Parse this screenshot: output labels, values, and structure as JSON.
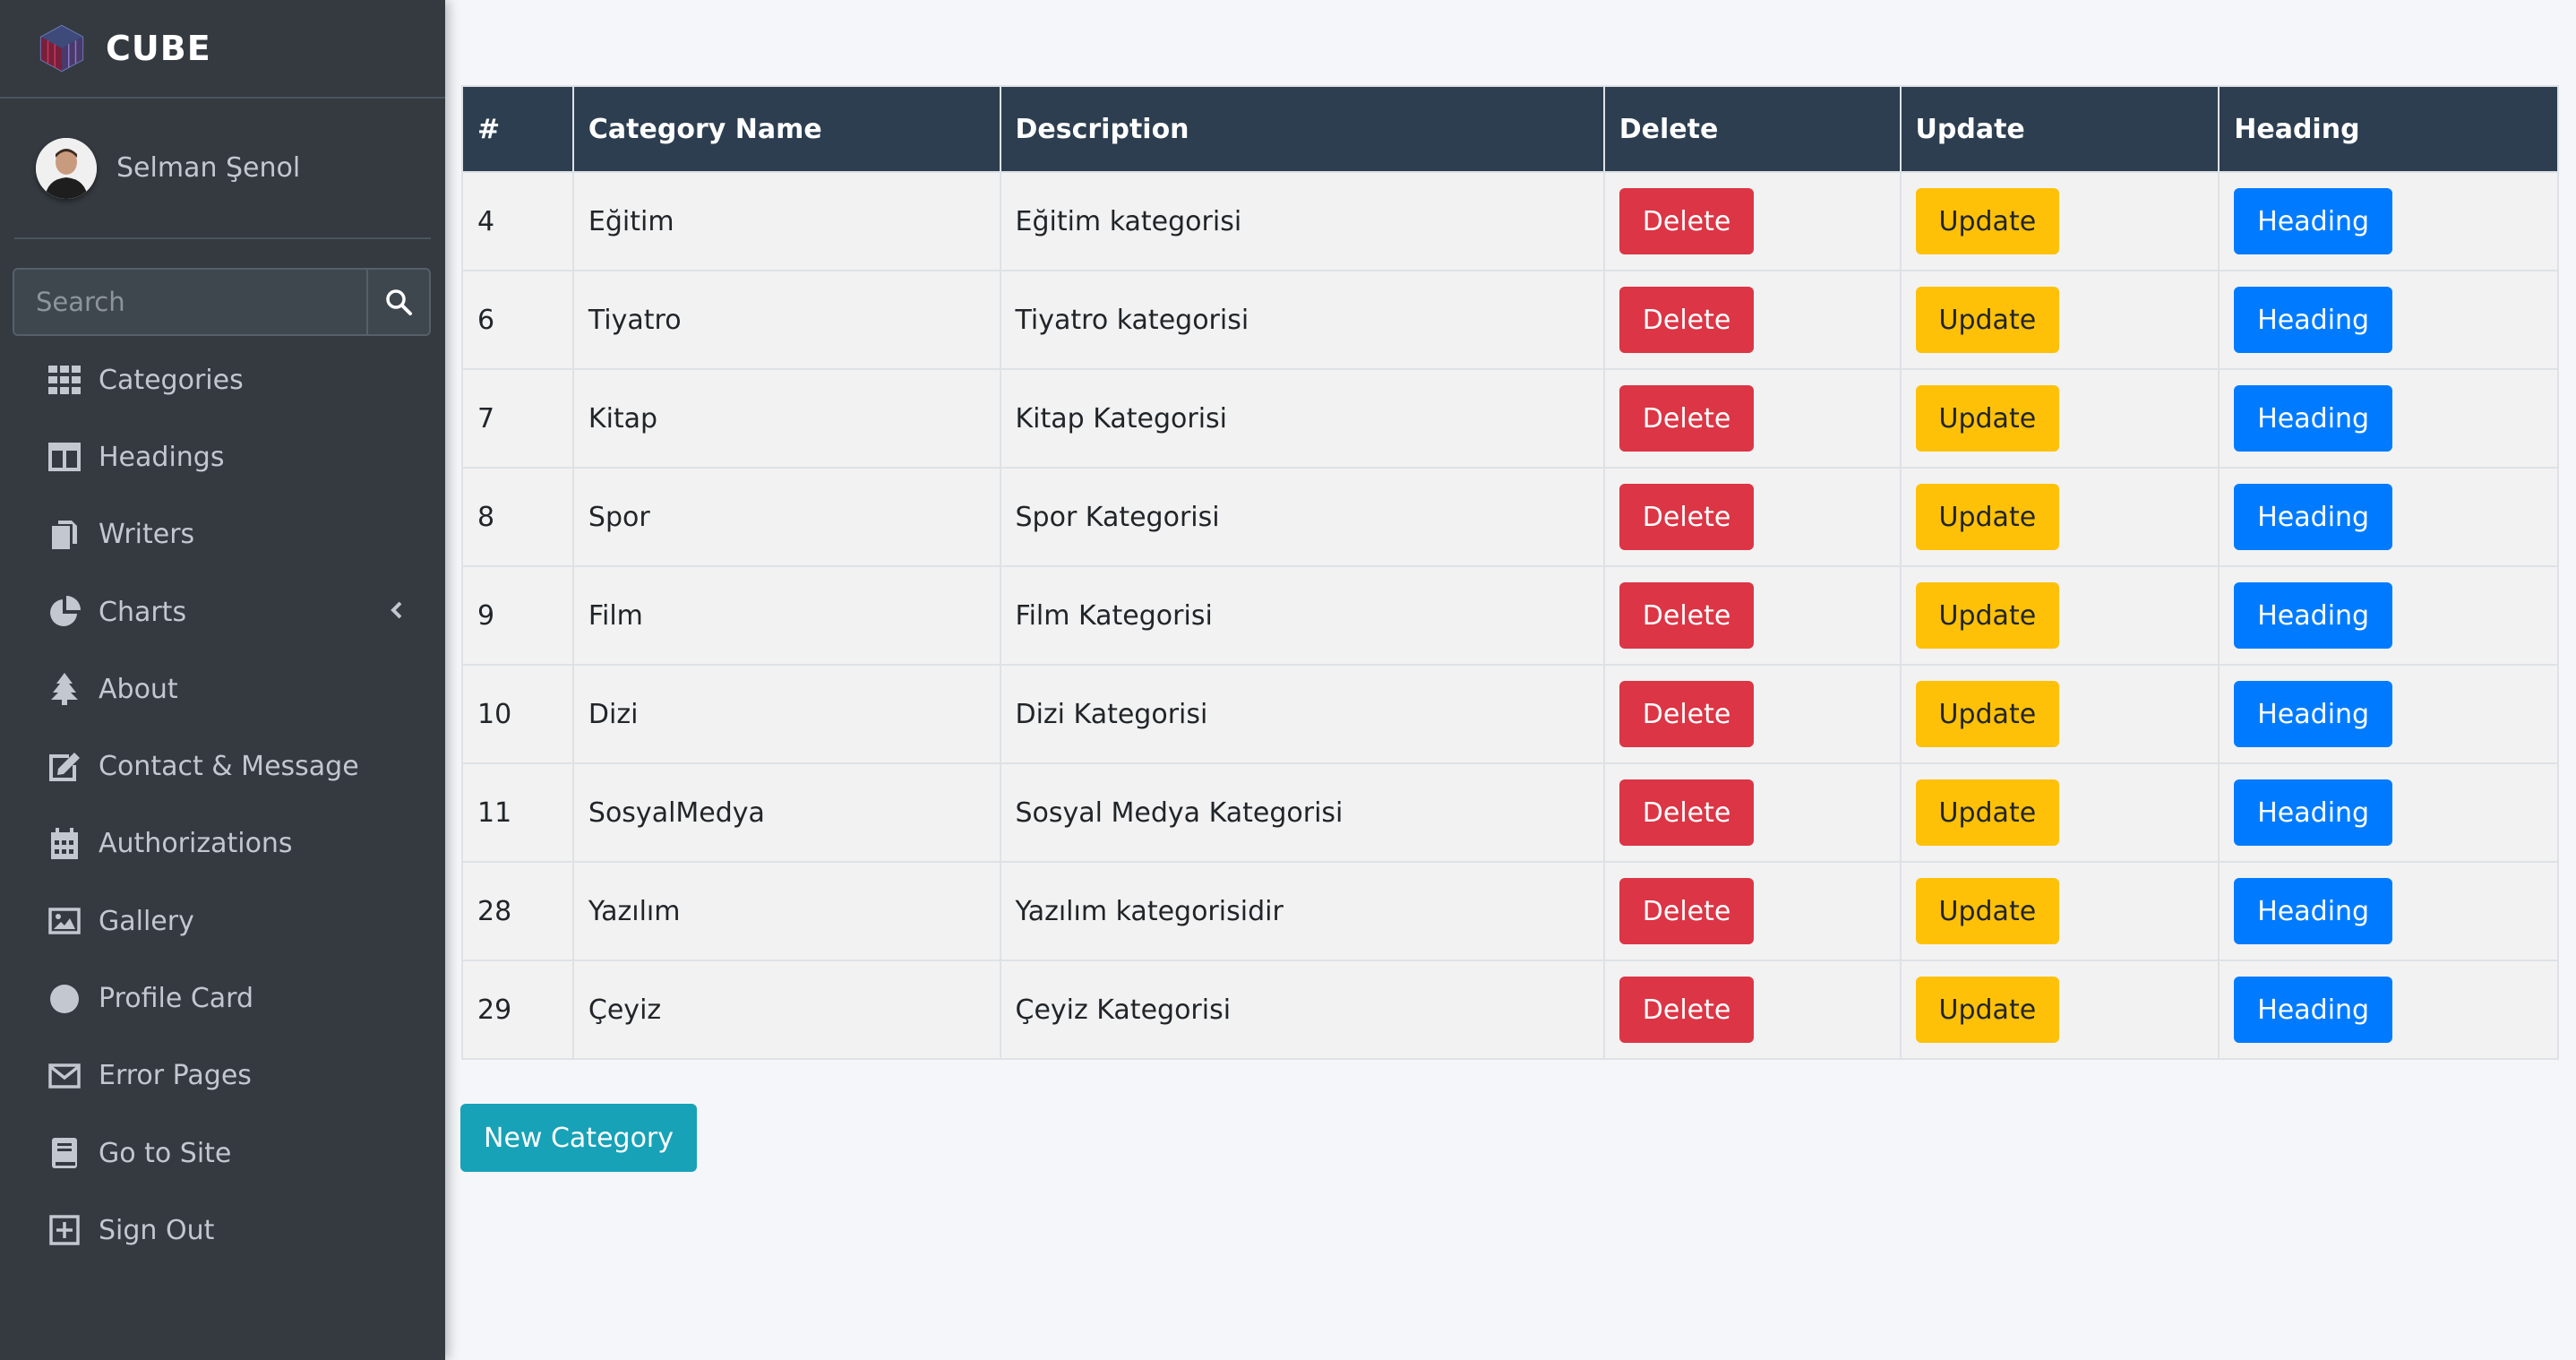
{
  "brand": {
    "name": "CUBE"
  },
  "user": {
    "name": "Selman Şenol"
  },
  "search": {
    "placeholder": "Search"
  },
  "sidebar": {
    "items": [
      {
        "label": "Categories",
        "icon": "grid-icon"
      },
      {
        "label": "Headings",
        "icon": "columns-icon"
      },
      {
        "label": "Writers",
        "icon": "copy-icon"
      },
      {
        "label": "Charts",
        "icon": "pie-chart-icon",
        "has_arrow": true
      },
      {
        "label": "About",
        "icon": "tree-icon"
      },
      {
        "label": "Contact & Message",
        "icon": "edit-icon"
      },
      {
        "label": "Authorizations",
        "icon": "calendar-icon"
      },
      {
        "label": "Gallery",
        "icon": "image-icon"
      },
      {
        "label": "Profile Card",
        "icon": "circle-icon"
      },
      {
        "label": "Error Pages",
        "icon": "envelope-icon"
      },
      {
        "label": "Go to Site",
        "icon": "book-icon"
      },
      {
        "label": "Sign Out",
        "icon": "plus-square-icon"
      }
    ]
  },
  "table": {
    "headers": [
      "#",
      "Category Name",
      "Description",
      "Delete",
      "Update",
      "Heading"
    ],
    "rows": [
      {
        "id": "4",
        "name": "Eğitim",
        "description": "Eğitim kategorisi"
      },
      {
        "id": "6",
        "name": "Tiyatro",
        "description": "Tiyatro kategorisi"
      },
      {
        "id": "7",
        "name": "Kitap",
        "description": "Kitap Kategorisi"
      },
      {
        "id": "8",
        "name": "Spor",
        "description": "Spor Kategorisi"
      },
      {
        "id": "9",
        "name": "Film",
        "description": "Film Kategorisi"
      },
      {
        "id": "10",
        "name": "Dizi",
        "description": "Dizi Kategorisi"
      },
      {
        "id": "11",
        "name": "SosyalMedya",
        "description": "Sosyal Medya Kategorisi"
      },
      {
        "id": "28",
        "name": "Yazılım",
        "description": "Yazılım kategorisidir"
      },
      {
        "id": "29",
        "name": "Çeyiz",
        "description": "Çeyiz Kategorisi"
      }
    ],
    "delete_label": "Delete",
    "update_label": "Update",
    "heading_label": "Heading"
  },
  "actions": {
    "new_category_label": "New Category"
  },
  "colors": {
    "sidebar_bg": "#343a40",
    "header_bg": "#2c3e50",
    "danger": "#dc3545",
    "warning": "#ffc107",
    "primary": "#007bff",
    "info": "#17a2b8"
  }
}
